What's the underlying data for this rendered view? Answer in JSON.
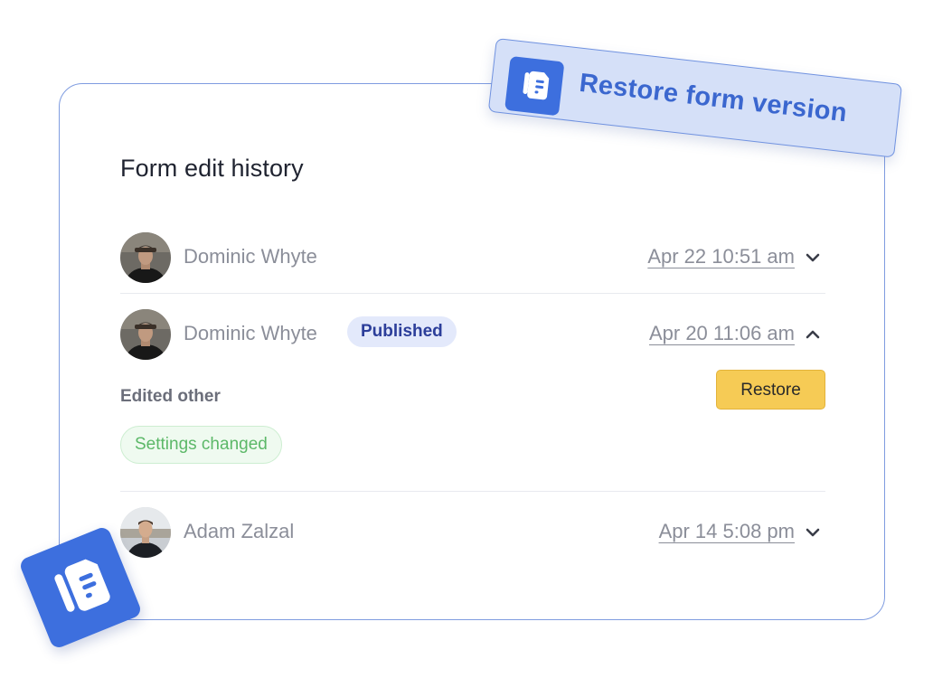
{
  "card": {
    "title": "Form edit history"
  },
  "entries": [
    {
      "user": "Dominic Whyte",
      "avatar": "avatar-dominic",
      "date": "Apr 22 10:51 am",
      "chevron": "chevron-down-icon",
      "expanded": false
    },
    {
      "user": "Dominic Whyte",
      "avatar": "avatar-dominic",
      "badge": "Published",
      "date": "Apr 20 11:06 am",
      "chevron": "chevron-up-icon",
      "expanded": true,
      "details": {
        "label": "Edited other",
        "changes": [
          "Settings changed"
        ],
        "restore_label": "Restore"
      }
    },
    {
      "user": "Adam Zalzal",
      "avatar": "avatar-adam",
      "date": "Apr 14 5:08 pm",
      "chevron": "chevron-down-icon",
      "expanded": false
    }
  ],
  "callout": {
    "text": "Restore form version",
    "icon": "form-logo-icon"
  },
  "corner_logo": {
    "icon": "form-logo-icon"
  },
  "colors": {
    "brand_blue": "#3d6fde",
    "restore_button": "#f6cb55",
    "badge_bg": "#e3e9fb",
    "chip_green": "#5cb868",
    "card_border": "#7f9ce0"
  }
}
